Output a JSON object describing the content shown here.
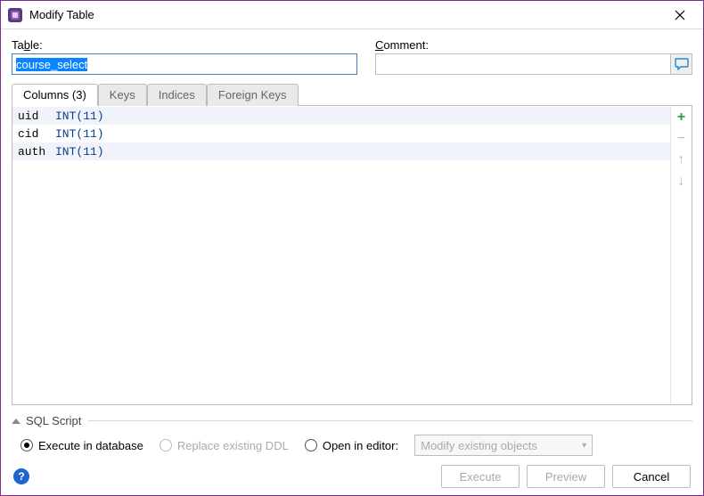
{
  "window": {
    "title": "Modify Table"
  },
  "fields": {
    "table_label_pre": "Ta",
    "table_label_u": "b",
    "table_label_post": "le:",
    "table_value": "course_select",
    "comment_label_u": "C",
    "comment_label_post": "omment:",
    "comment_value": ""
  },
  "tabs": [
    {
      "label": "Columns (3)",
      "active": true
    },
    {
      "label": "Keys",
      "active": false
    },
    {
      "label": "Indices",
      "active": false
    },
    {
      "label": "Foreign Keys",
      "active": false
    }
  ],
  "columns": [
    {
      "name": "uid",
      "type": "INT",
      "args": "(11)"
    },
    {
      "name": "cid",
      "type": "INT",
      "args": "(11)"
    },
    {
      "name": "auth",
      "type": "INT",
      "args": "(11)"
    }
  ],
  "side_actions": {
    "add": "+",
    "remove": "−",
    "up": "↑",
    "down": "↓"
  },
  "section": {
    "script_label": "SQL Script"
  },
  "radios": {
    "execute_db": "Execute in database",
    "replace_ddl": "Replace existing DDL",
    "open_editor": "Open in editor:"
  },
  "combo": {
    "placeholder": "Modify existing objects"
  },
  "buttons": {
    "execute": "Execute",
    "preview": "Preview",
    "cancel": "Cancel"
  },
  "help": "?"
}
